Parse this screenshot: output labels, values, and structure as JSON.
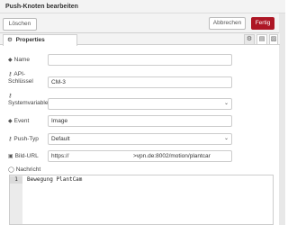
{
  "window": {
    "title": "Push-Knoten bearbeiten"
  },
  "toolbar": {
    "delete_label": "Löschen",
    "cancel_label": "Abbrechen",
    "done_label": "Fertig"
  },
  "tabs": {
    "properties_label": "Properties"
  },
  "form": {
    "name": {
      "label": "Name",
      "value": ""
    },
    "api_key": {
      "label_line1": "API-",
      "label_line2": "Schlüssel",
      "value": "CM-3"
    },
    "system_variable": {
      "label": "Systemvariable",
      "value": ""
    },
    "event": {
      "label": "Event",
      "value": "Image"
    },
    "push_type": {
      "label": "Push-Typ",
      "value": "Default"
    },
    "image_url": {
      "label": "Bild-URL",
      "value_left": "https://",
      "value_right": ">vpn.de:8002/motion/plantcar"
    },
    "message": {
      "label": "Nachricht",
      "line_number": "1",
      "code": "Bewegung PlantCam"
    }
  },
  "icons": {
    "gear": "⚙",
    "tag": "🏷",
    "key": "⚷",
    "image": "▣",
    "comment": "◯"
  }
}
